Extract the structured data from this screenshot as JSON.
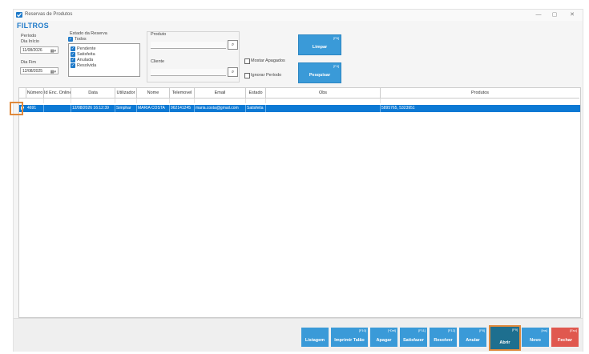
{
  "window": {
    "title": "Reservas de Produtos",
    "minimize": "—",
    "maximize": "▢",
    "close": "✕"
  },
  "filters": {
    "title": "FILTROS",
    "periodo": {
      "label": "Período",
      "dia_inicio_label": "Dia Início",
      "dia_inicio": "11/08/2026",
      "dia_fim_label": "Dia Fim",
      "dia_fim": "12/08/2025"
    },
    "estado": {
      "label": "Estado da Reserva",
      "todos": "Todos",
      "options": [
        "Pendente",
        "Satisfeita",
        "Anulada",
        "Resolvida"
      ]
    },
    "produto_label": "Produto",
    "cliente_label": "Cliente",
    "mostrar_apagados": "Mostar Apagados",
    "ignorar_periodo": "Ignorar Período",
    "limpar": {
      "label": "Limpar",
      "key": "[F6]"
    },
    "pesquisar": {
      "label": "Pesquisar",
      "key": "[F4]"
    }
  },
  "table": {
    "columns": [
      "Número",
      "Id Enc. Online",
      "Data",
      "Utilizador",
      "Nome",
      "Telemovel",
      "Email",
      "Estado",
      "Obs",
      "Produtos"
    ],
    "rows": [
      {
        "numero": "4691",
        "id_enc": "",
        "data": "12/08/2026 16:12:39",
        "utilizador": "Simphar",
        "nome": "MARIA COSTA",
        "telemovel": "962141245",
        "email": "maria.costa@gmail.com",
        "estado": "Satisfeita",
        "obs": "",
        "produtos": "5895765, 5323951"
      }
    ]
  },
  "buttons": [
    {
      "key": "",
      "label": "Listagem"
    },
    {
      "key": "[F10]",
      "label": "Imprimir Talão"
    },
    {
      "key": "[^Del]",
      "label": "Apagar"
    },
    {
      "key": "[F11]",
      "label": "Satisfazer"
    },
    {
      "key": "[F12]",
      "label": "Resolver"
    },
    {
      "key": "[F8]",
      "label": "Anular"
    },
    {
      "key": "[F9]",
      "label": "Abrir"
    },
    {
      "key": "[Ins]",
      "label": "Novo"
    },
    {
      "key": "[Esc]",
      "label": "Fechar"
    }
  ],
  "colors": {
    "accent": "#1f7ac9",
    "button": "#3a9ad8",
    "selected_row": "#0c79d4",
    "abrir": "#1e6f8f",
    "fechar": "#e0584f",
    "highlight": "#e08a3c"
  },
  "icons": {
    "app": "checkmark-icon",
    "search": "magnifier-icon",
    "calendar": "calendar-icon"
  }
}
